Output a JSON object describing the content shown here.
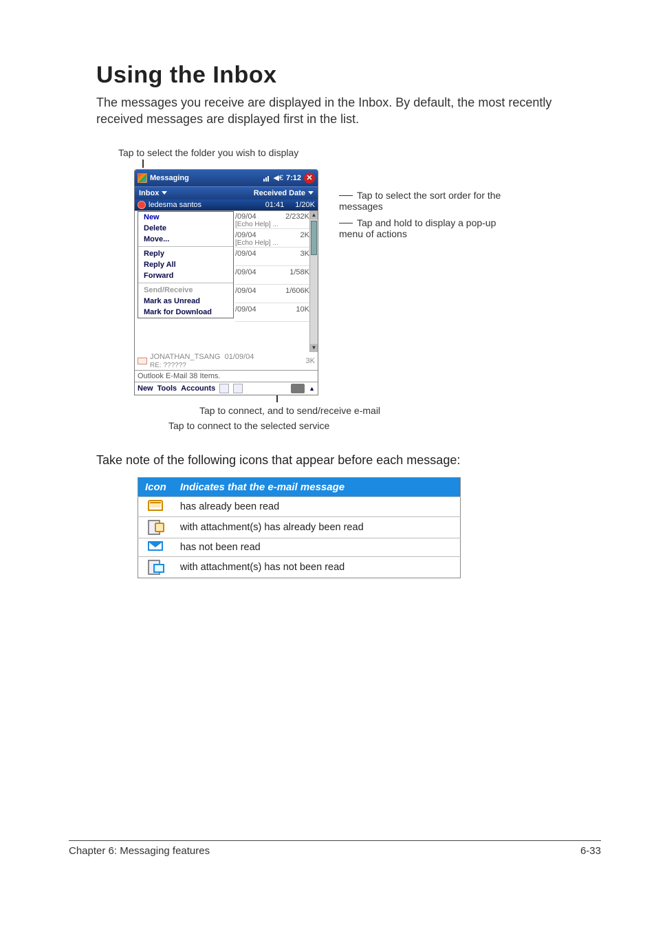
{
  "heading": "Using the Inbox",
  "intro": "The messages you receive are displayed in the Inbox. By default, the most recently received messages are displayed first in the list.",
  "caption_top": "Tap to select the folder you wish to display",
  "annotations": {
    "sort": "Tap to select the sort order for the messages",
    "hold": "Tap and hold to display a pop-up menu of actions",
    "send": "Tap to connect, and to send/receive e-mail",
    "connect": "Tap to connect to the selected service"
  },
  "note": "Take note of the following icons that appear before each message:",
  "screenshot": {
    "app_title": "Messaging",
    "time": "7:12",
    "folder": "Inbox",
    "sort_label": "Received Date",
    "selected_row": {
      "name": "ledesma santos",
      "time": "01:41",
      "size": "1/20K"
    },
    "context_menu": [
      "New",
      "Delete",
      "Move...",
      "—",
      "Reply",
      "Reply All",
      "Forward",
      "—",
      "Send/Receive",
      "Mark as Unread",
      "Mark for Download"
    ],
    "context_disabled_index": 8,
    "rows": [
      {
        "date": "/09/04",
        "size": "2/232K",
        "sub": "[Echo Help] ..."
      },
      {
        "date": "/09/04",
        "size": "2K",
        "sub": "[Echo Help] ..."
      },
      {
        "date": "/09/04",
        "size": "3K",
        "sub": ""
      },
      {
        "date": "/09/04",
        "size": "1/58K",
        "sub": ""
      },
      {
        "date": "/09/04",
        "size": "1/606K",
        "sub": ""
      },
      {
        "date": "/09/04",
        "size": "10K",
        "sub": ""
      }
    ],
    "below_row": {
      "name": "JONATHAN_TSANG",
      "date": "01/09/04",
      "size": "3K",
      "sub": "RE: ??????"
    },
    "status": "Outlook E-Mail  38 Items.",
    "bottom": [
      "New",
      "Tools",
      "Accounts"
    ]
  },
  "icon_table": {
    "headers": [
      "Icon",
      "Indicates that the e-mail message"
    ],
    "rows": [
      {
        "icon": "read",
        "text": "has already been read"
      },
      {
        "icon": "read-attach",
        "text": "with attachment(s) has already been read"
      },
      {
        "icon": "unread",
        "text": "has not been read"
      },
      {
        "icon": "unread-attach",
        "text": "with attachment(s) has not been read"
      }
    ]
  },
  "footer": {
    "left": "Chapter 6: Messaging features",
    "right": "6-33"
  }
}
